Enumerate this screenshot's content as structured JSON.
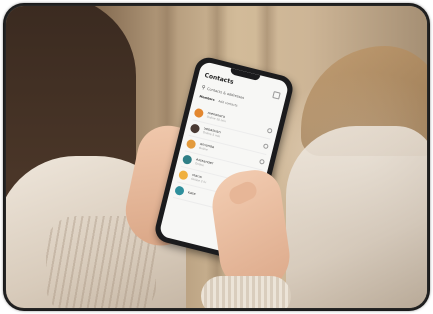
{
  "phone_app": {
    "title": "Contacts",
    "search_label": "Contacts & addresses",
    "tabs": [
      {
        "label": "Members",
        "active": true
      },
      {
        "label": "Add contacts",
        "active": false
      }
    ],
    "contacts": [
      {
        "name": "Alexandra",
        "sub": "Online 10 min",
        "color": "#e3872f"
      },
      {
        "name": "Sebastian",
        "sub": "Online 5 min",
        "color": "#4a3a33"
      },
      {
        "name": "Amanda",
        "sub": "Online",
        "color": "#e39a3c"
      },
      {
        "name": "Alexander",
        "sub": "Online",
        "color": "#2f7f86"
      },
      {
        "name": "Maria",
        "sub": "Online 2 hr",
        "color": "#f0b03e"
      },
      {
        "name": "Kate",
        "sub": "",
        "color": "#2e8f9c"
      }
    ]
  }
}
